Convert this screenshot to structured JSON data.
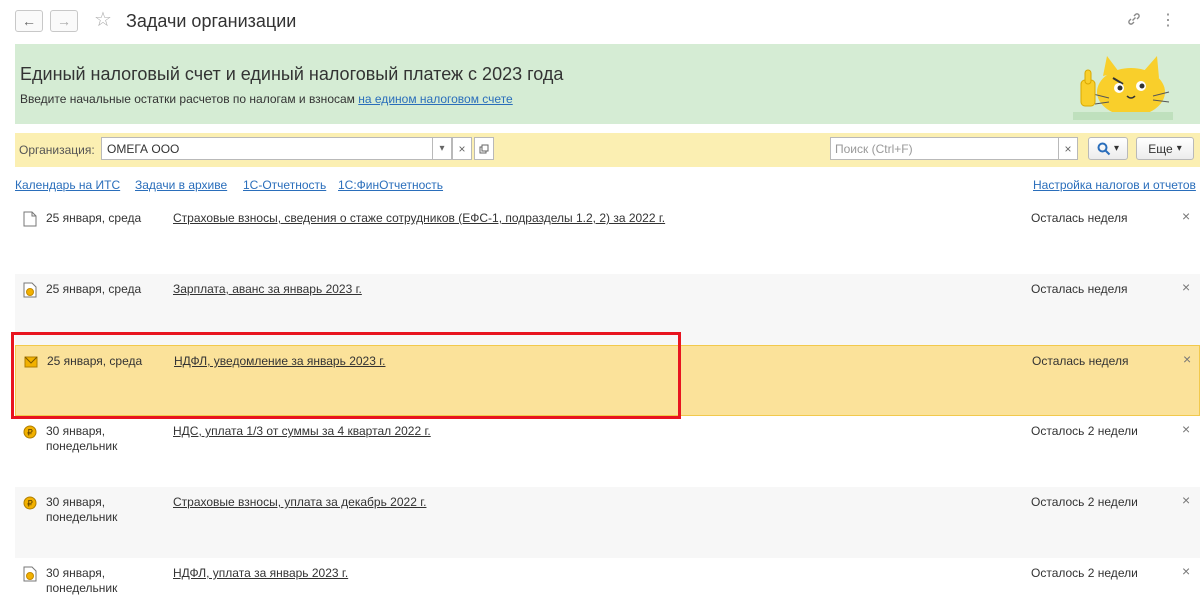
{
  "header": {
    "title": "Задачи организации",
    "back_icon": "←",
    "forward_icon": "→",
    "star_icon": "☆",
    "link_icon": "🔗",
    "menu_icon": "⋮"
  },
  "banner": {
    "title": "Единый налоговый счет и единый налоговый платеж с 2023 года",
    "text": "Введите начальные остатки расчетов по налогам и взносам",
    "link": "на едином налоговом счете"
  },
  "toolbar": {
    "org_label": "Организация:",
    "org_value": "ОМЕГА ООО",
    "search_placeholder": "Поиск (Ctrl+F)",
    "more_label": "Еще",
    "dropdown_glyph": "▾",
    "clear_glyph": "×"
  },
  "links": {
    "calendar": "Календарь на ИТС",
    "archive": "Задачи в архиве",
    "reporting": "1С-Отчетность",
    "fin_reporting": "1С:ФинОтчетность",
    "settings": "Настройка налогов и отчетов"
  },
  "tasks": [
    {
      "date": "25 января, среда",
      "task": "Страховые взносы, сведения о стаже сотрудников (ЕФС-1, подразделы 1.2, 2) за 2022 г.",
      "status": "Осталась неделя",
      "icon": "document-icon"
    },
    {
      "date": "25 января, среда",
      "task": "Зарплата, аванс за январь 2023 г.",
      "status": "Осталась неделя",
      "icon": "payment-doc-icon"
    },
    {
      "date": "25 января, среда",
      "task": "НДФЛ, уведомление за январь 2023 г.",
      "status": "Осталась неделя",
      "icon": "envelope-icon"
    },
    {
      "date": "30 января,\nпонедельник",
      "task": "НДС, уплата 1/3 от суммы за 4 квартал 2022 г.",
      "status": "Осталось 2 недели",
      "icon": "ruble-coin-icon"
    },
    {
      "date": "30 января,\nпонедельник",
      "task": "Страховые взносы, уплата за декабрь 2022 г.",
      "status": "Осталось 2 недели",
      "icon": "ruble-coin-icon"
    },
    {
      "date": "30 января,\nпонедельник",
      "task": "НДФЛ, уплата за январь 2023 г.",
      "status": "Осталось 2 недели",
      "icon": "payment-doc-icon"
    }
  ],
  "close_glyph": "×",
  "colors": {
    "banner_bg": "#d5ecd4",
    "toolbar_bg": "#fbefb2",
    "selected_row_bg": "#fbe29a",
    "highlight_border": "#e8141f",
    "link": "#2a6ebb"
  }
}
